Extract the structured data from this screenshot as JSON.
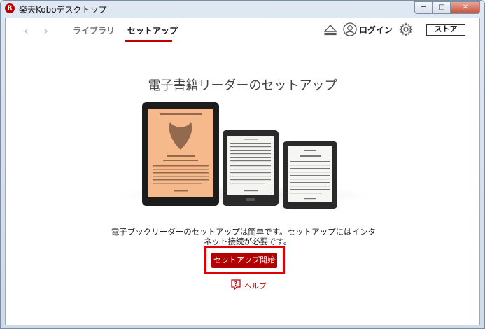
{
  "window": {
    "title": "楽天Koboデスクトップ",
    "app_icon_letter": "R",
    "minimize": "─",
    "maximize": "□",
    "close": "✕"
  },
  "toolbar": {
    "back_arrow": "‹",
    "forward_arrow": "›",
    "tabs": [
      {
        "label": "ライブラリ",
        "active": false
      },
      {
        "label": "セットアップ",
        "active": true
      }
    ],
    "login_label": "ログイン",
    "store_label": "ストア",
    "icons": [
      "eject-icon",
      "avatar-icon",
      "gear-icon"
    ]
  },
  "main": {
    "title": "電子書籍リーダーのセットアップ",
    "description": "電子ブックリーダーのセットアップは簡単です。セットアップにはインターネット接続が必要です。",
    "start_button": "セットアップ開始",
    "help_link": "ヘルプ"
  },
  "colors": {
    "brand_red": "#bf0000",
    "highlight_red": "#e00000"
  }
}
